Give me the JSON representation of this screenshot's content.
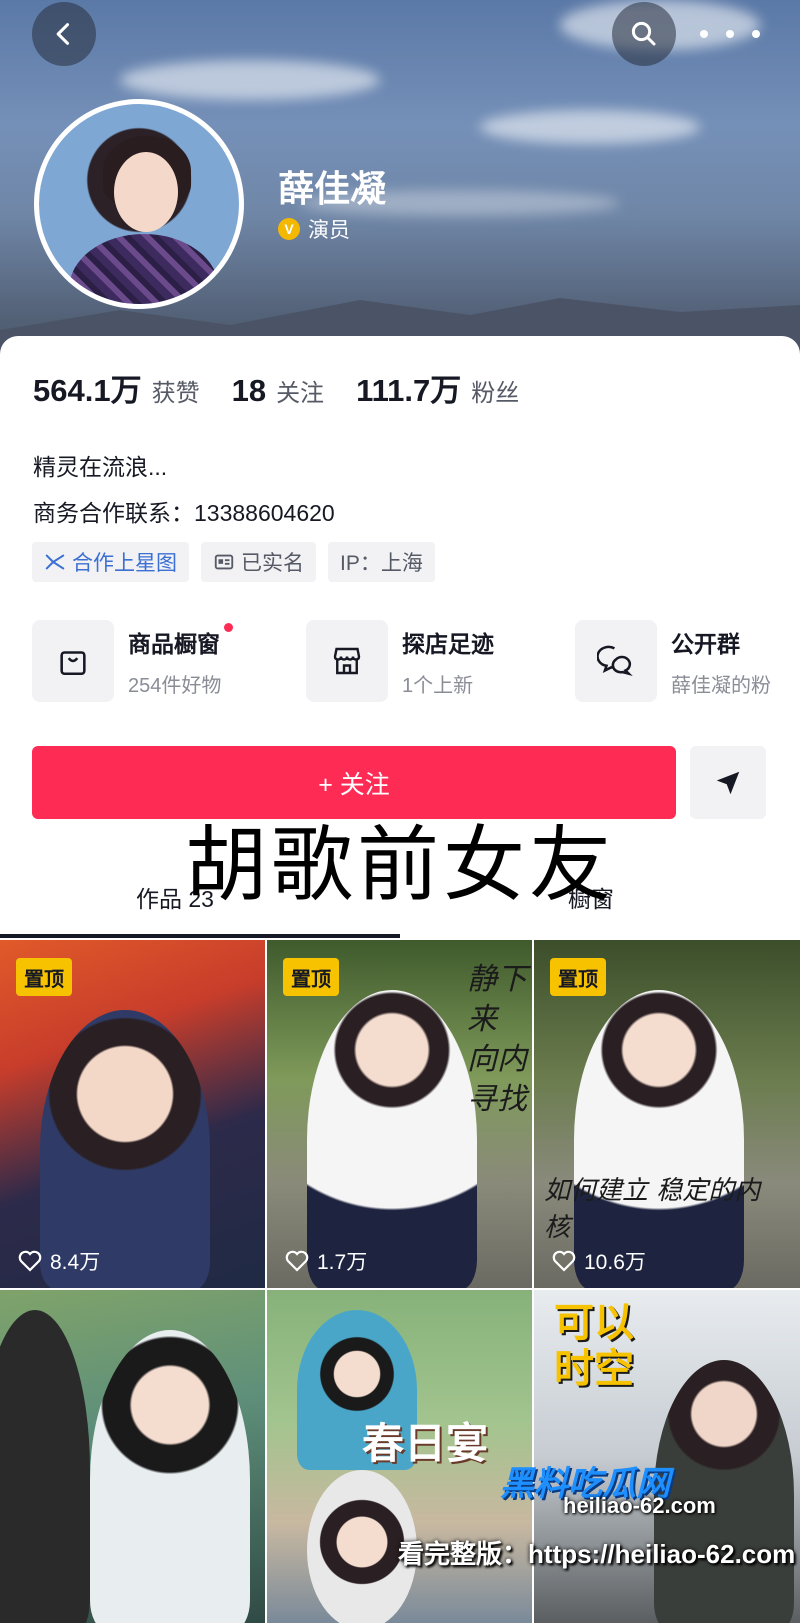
{
  "profile": {
    "name": "薛佳凝",
    "verify_badge": "V",
    "verify_title": "演员",
    "bio": "精灵在流浪...",
    "contact": "商务合作联系：13388604620"
  },
  "stats": [
    {
      "value": "564.1万",
      "label": "获赞"
    },
    {
      "value": "18",
      "label": "关注"
    },
    {
      "value": "111.7万",
      "label": "粉丝"
    }
  ],
  "tags": [
    {
      "label": "合作上星图",
      "icon": "star-map-icon"
    },
    {
      "label": "已实名",
      "icon": "id-card-icon"
    },
    {
      "label": "IP：上海",
      "icon": ""
    }
  ],
  "shortcuts": [
    {
      "title": "商品橱窗",
      "subtitle": "254件好物",
      "icon": "shopping-bag-icon",
      "has_dot": true
    },
    {
      "title": "探店足迹",
      "subtitle": "1个上新",
      "icon": "store-icon",
      "has_dot": false
    },
    {
      "title": "公开群",
      "subtitle": "薛佳凝的粉",
      "icon": "chat-bubbles-icon",
      "has_dot": false
    }
  ],
  "actions": {
    "follow_label": "+ 关注",
    "share_icon": "send-icon"
  },
  "tabs": {
    "works_label": "作品",
    "works_count": "23",
    "other_label": "橱窗"
  },
  "overlay_caption": "胡歌前女友",
  "videos": [
    {
      "pinned": true,
      "pin_label": "置顶",
      "likes": "8.4万"
    },
    {
      "pinned": true,
      "pin_label": "置顶",
      "likes": "1.7万",
      "caption": "静下来 向内寻找"
    },
    {
      "pinned": true,
      "pin_label": "置顶",
      "likes": "10.6万",
      "caption": "如何建立 稳定的内核"
    },
    {
      "pinned": false
    },
    {
      "pinned": false,
      "caption": "春日宴"
    },
    {
      "pinned": false,
      "caption": "可以 时空"
    }
  ],
  "watermark": {
    "brand": "黑料吃瓜网",
    "url": "heiliao-62.com",
    "full_label": "看完整版：https://heiliao-62.com"
  },
  "colors": {
    "accent": "#fe2c55",
    "pin": "#f7c300",
    "tag_blue": "#3b6fd4"
  }
}
